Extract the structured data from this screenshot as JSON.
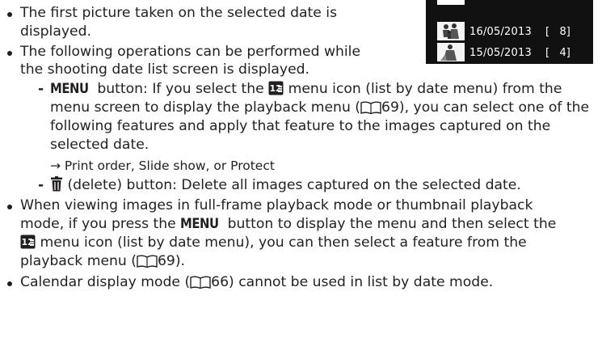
{
  "bullets": {
    "first_a": "The first picture taken on the selected date is",
    "first_b": "displayed.",
    "ops_a": "The following operations can be performed while",
    "ops_b": "the shooting date list screen is displayed."
  },
  "menu_item": {
    "key": "MENU",
    "l1_a": " button: If you select the ",
    "l1_b": " menu icon (list by date menu) from the",
    "l2_a": "menu screen to display the playback menu (",
    "l2_b": "69), you can select one of the",
    "l3": "following features and apply that feature to the images captured on the",
    "l4": "selected date.",
    "l5": "→ Print order, Slide show, or Protect"
  },
  "delete_item": {
    "text": " (delete) button: Delete all images captured on the selected date."
  },
  "viewing": {
    "l1": "When viewing images in full-frame playback mode or thumbnail playback",
    "l2_a": "mode, if you press the ",
    "l2_key": "MENU",
    "l2_b": " button to display the menu and then select the",
    "l3": " menu icon (list by date menu), you can then select a feature from the",
    "l4_a": "playback menu (",
    "l4_b": "69)."
  },
  "calendar": {
    "a": "Calendar display mode (",
    "b": "66) cannot be used in list by date mode."
  },
  "date_list": {
    "rows": [
      {
        "date": "16/05/2013",
        "count": "[   8]"
      },
      {
        "date": "15/05/2013",
        "count": "[   4]"
      }
    ]
  }
}
